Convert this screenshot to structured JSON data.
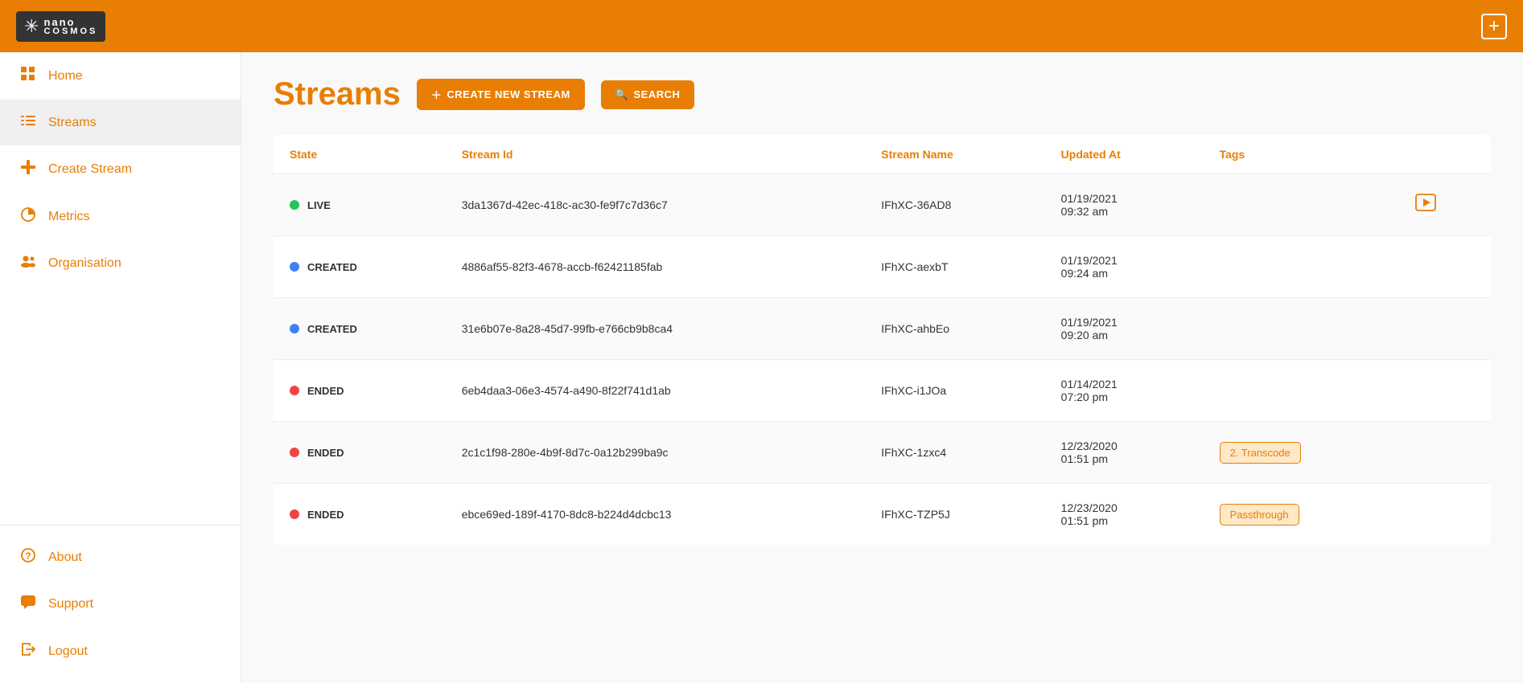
{
  "header": {
    "logo_nano": "nano",
    "logo_cosmos": "COSMOS",
    "plus_label": "+"
  },
  "sidebar": {
    "top_items": [
      {
        "id": "home",
        "label": "Home",
        "icon": "grid"
      },
      {
        "id": "streams",
        "label": "Streams",
        "icon": "list",
        "active": true
      },
      {
        "id": "create-stream",
        "label": "Create Stream",
        "icon": "plus"
      },
      {
        "id": "metrics",
        "label": "Metrics",
        "icon": "chart"
      },
      {
        "id": "organisation",
        "label": "Organisation",
        "icon": "users"
      }
    ],
    "bottom_items": [
      {
        "id": "about",
        "label": "About",
        "icon": "question"
      },
      {
        "id": "support",
        "label": "Support",
        "icon": "chat"
      },
      {
        "id": "logout",
        "label": "Logout",
        "icon": "logout"
      }
    ]
  },
  "main": {
    "page_title": "Streams",
    "btn_create": "CREATE NEW STREAM",
    "btn_search": "SEARCH",
    "table": {
      "columns": [
        "State",
        "Stream Id",
        "Stream Name",
        "Updated At",
        "Tags"
      ],
      "rows": [
        {
          "state": "LIVE",
          "state_color": "green",
          "stream_id": "3da1367d-42ec-418c-ac30-fe9f7c7d36c7",
          "stream_name": "IFhXC-36AD8",
          "updated_at": "01/19/2021\n09:32 am",
          "tags": "",
          "has_play": true
        },
        {
          "state": "CREATED",
          "state_color": "blue",
          "stream_id": "4886af55-82f3-4678-accb-f62421185fab",
          "stream_name": "IFhXC-aexbT",
          "updated_at": "01/19/2021\n09:24 am",
          "tags": "",
          "has_play": false
        },
        {
          "state": "CREATED",
          "state_color": "blue",
          "stream_id": "31e6b07e-8a28-45d7-99fb-e766cb9b8ca4",
          "stream_name": "IFhXC-ahbEo",
          "updated_at": "01/19/2021\n09:20 am",
          "tags": "",
          "has_play": false
        },
        {
          "state": "ENDED",
          "state_color": "red",
          "stream_id": "6eb4daa3-06e3-4574-a490-8f22f741d1ab",
          "stream_name": "IFhXC-i1JOa",
          "updated_at": "01/14/2021\n07:20 pm",
          "tags": "",
          "has_play": false
        },
        {
          "state": "ENDED",
          "state_color": "red",
          "stream_id": "2c1c1f98-280e-4b9f-8d7c-0a12b299ba9c",
          "stream_name": "IFhXC-1zxc4",
          "updated_at": "12/23/2020\n01:51 pm",
          "tags": "2. Transcode",
          "tag_type": "transcode",
          "has_play": false
        },
        {
          "state": "ENDED",
          "state_color": "red",
          "stream_id": "ebce69ed-189f-4170-8dc8-b224d4dcbc13",
          "stream_name": "IFhXC-TZP5J",
          "updated_at": "12/23/2020\n01:51 pm",
          "tags": "Passthrough",
          "tag_type": "passthrough",
          "has_play": false
        }
      ]
    }
  }
}
